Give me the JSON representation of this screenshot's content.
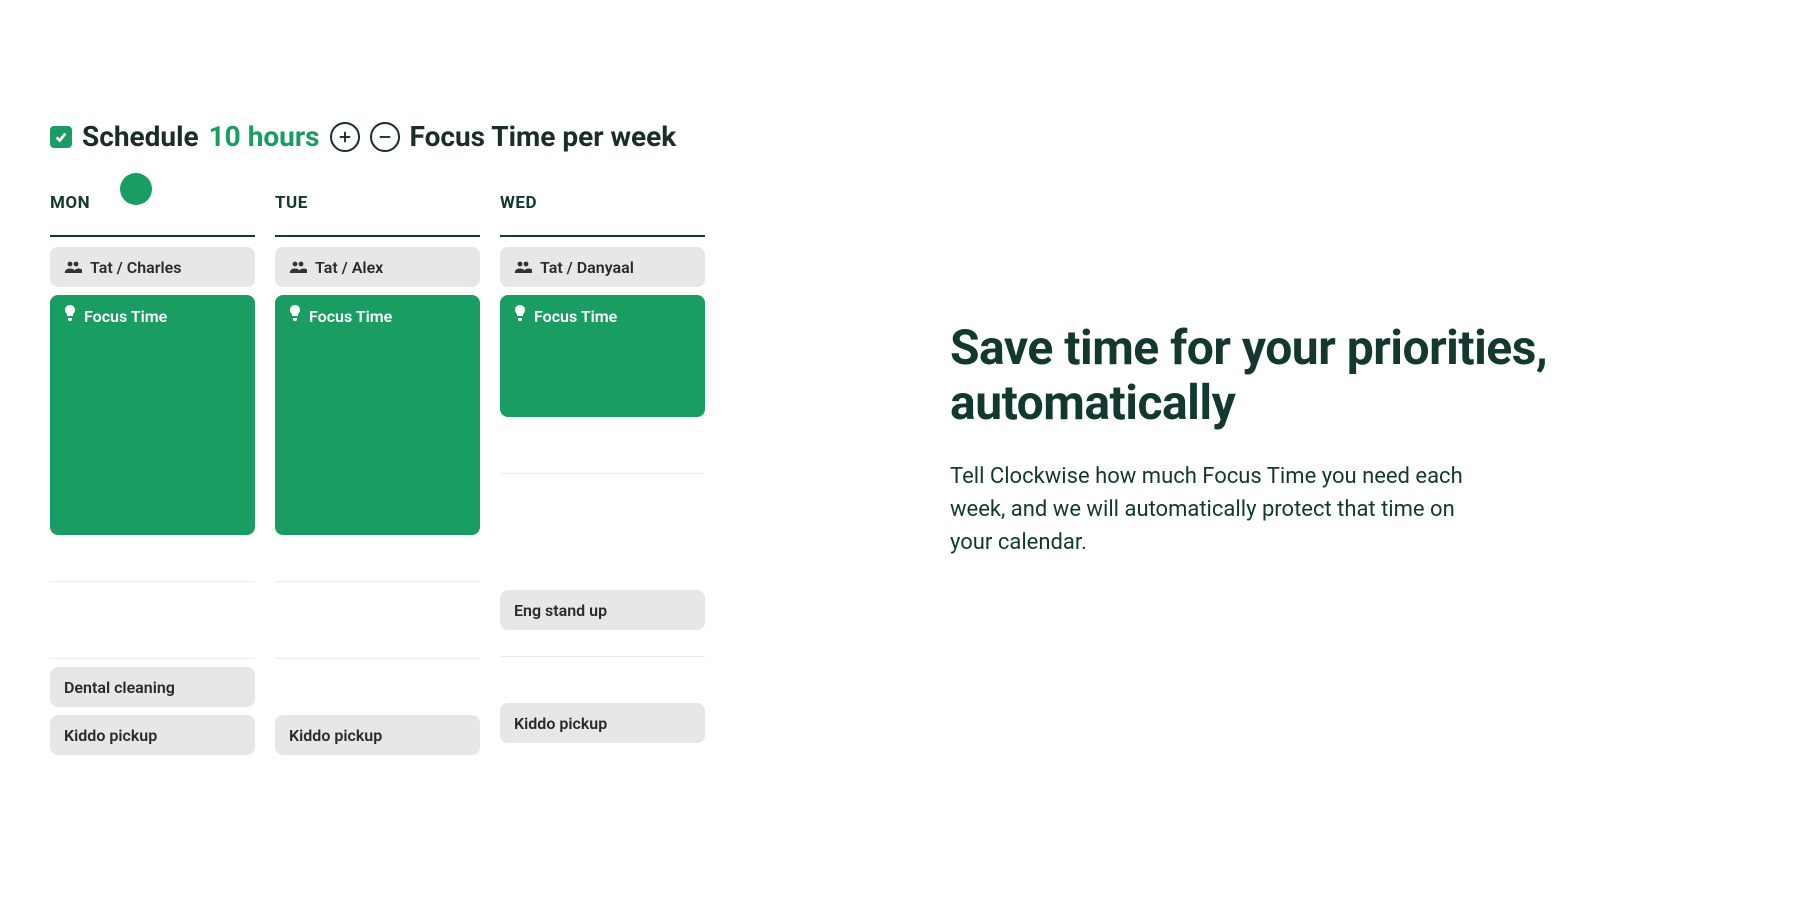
{
  "header": {
    "prefix": "Schedule",
    "hours": "10 hours",
    "suffix": "Focus Time per week"
  },
  "calendar": {
    "days": [
      {
        "label": "MON",
        "meeting": "Tat / Charles",
        "focus": "Focus Time",
        "focus_height": 240,
        "gap_after_focus": 123,
        "mid_event": "Dental cleaning",
        "bottom": "Kiddo pickup"
      },
      {
        "label": "TUE",
        "meeting": "Tat / Alex",
        "focus": "Focus Time",
        "focus_height": 240,
        "gap_after_focus": 163,
        "mid_event": "",
        "bottom": "Kiddo pickup"
      },
      {
        "label": "WED",
        "meeting": "Tat / Danyaal",
        "focus": "Focus Time",
        "focus_height": 122,
        "gap_after_focus": 156,
        "mid_event": "Eng stand up",
        "gap_after_mid": 77,
        "bottom": "Kiddo pickup"
      }
    ]
  },
  "marketing": {
    "headline": "Save time for your priorities, automatically",
    "body": "Tell Clockwise how much Focus Time you need each week, and we will automatically protect that time on your calendar."
  }
}
